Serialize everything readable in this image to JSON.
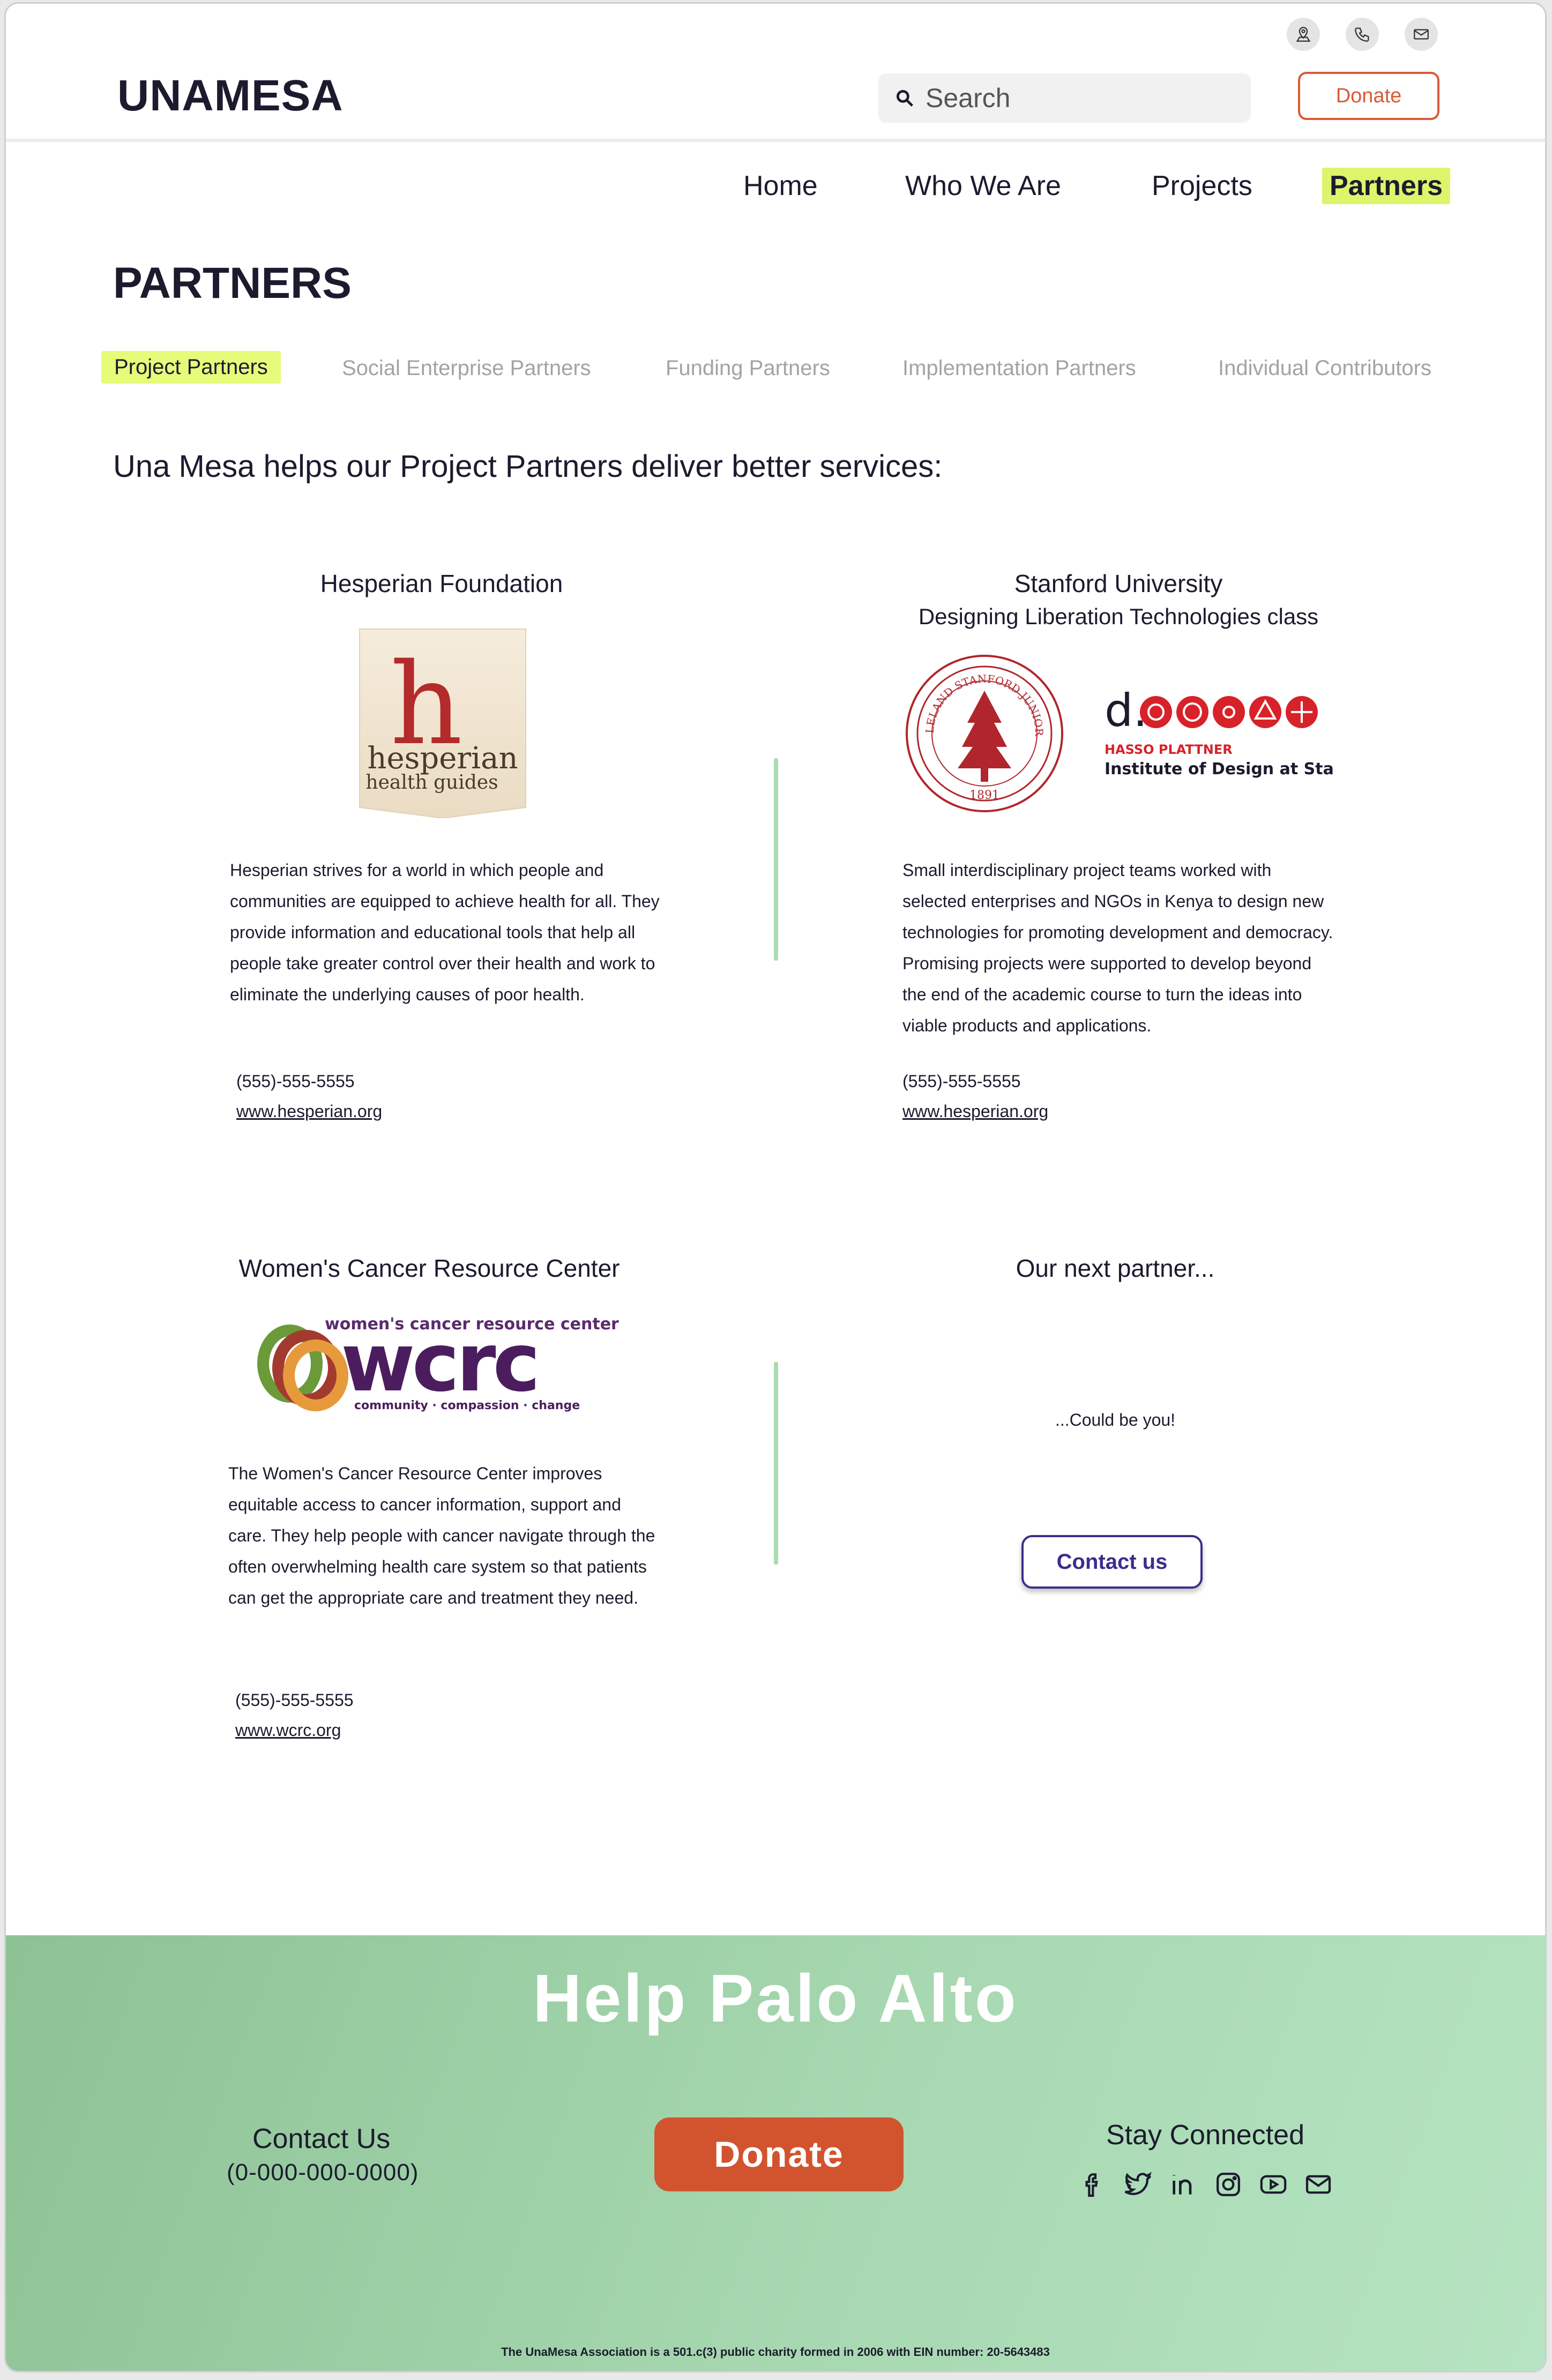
{
  "header": {
    "logo": "UNAMESA",
    "search_placeholder": "Search",
    "donate_label": "Donate",
    "utility_icons": [
      "location-icon",
      "phone-icon",
      "mail-icon"
    ]
  },
  "nav": {
    "items": [
      {
        "label": "Home"
      },
      {
        "label": "Who We Are"
      },
      {
        "label": "Projects"
      },
      {
        "label": "Partners",
        "active": true
      }
    ]
  },
  "page": {
    "title": "PARTNERS",
    "tabs": [
      {
        "label": "Project Partners",
        "active": true
      },
      {
        "label": "Social Enterprise Partners"
      },
      {
        "label": "Funding Partners"
      },
      {
        "label": "Implementation Partners"
      },
      {
        "label": "Individual Contributors"
      }
    ],
    "intro": "Una Mesa helps our Project Partners deliver better services:"
  },
  "partners": [
    {
      "name": "Hesperian Foundation",
      "logo_text": [
        "h",
        "hesperian",
        "health guides"
      ],
      "description": "Hesperian strives for a world in which people and communities are equipped to achieve health for all. They provide information and educational tools that help all people take greater control over their health and work to eliminate the underlying causes of poor health.",
      "phone": "(555)-555-5555",
      "url": "www.hesperian.org"
    },
    {
      "name": "Stanford University",
      "subtitle": "Designing Liberation Technologies class",
      "logo_text": [
        "LELAND STANFORD JUNIOR UNIVERSITY",
        "1891",
        "d.",
        "HASSO PLATTNER",
        "Institute of Design at Stanford"
      ],
      "description": "Small interdisciplinary project teams worked with selected enterprises and NGOs in Kenya to design new technologies for promoting development and democracy. Promising projects were supported to develop beyond the end of the academic course to turn the ideas into viable products and applications.",
      "phone": "(555)-555-5555",
      "url": "www.hesperian.org"
    },
    {
      "name": "Women's Cancer Resource Center",
      "logo_text": [
        "women's cancer resource center",
        "wcrc",
        "community · compassion · change"
      ],
      "description": "The Women's Cancer Resource Center improves equitable access to cancer information, support and care. They help people with cancer navigate through the often overwhelming health care system so that patients can get the appropriate care and treatment they need.",
      "phone": "(555)-555-5555",
      "url": "www.wcrc.org"
    },
    {
      "name": "Our next partner...",
      "description": "...Could be you!",
      "button_label": "Contact us"
    }
  ],
  "footer": {
    "title": "Help Palo Alto",
    "contact_heading": "Contact Us",
    "contact_phone": "(0-000-000-0000)",
    "donate_label": "Donate",
    "stay_connected": "Stay Connected",
    "social_icons": [
      "facebook-icon",
      "twitter-icon",
      "linkedin-icon",
      "instagram-icon",
      "youtube-icon",
      "mail-icon"
    ],
    "legal": "The UnaMesa Association is a 501.c(3) public charity formed in 2006 with EIN number: 20-5643483"
  },
  "colors": {
    "accent_orange": "#d95a38",
    "highlight_lime": "#dcf56a",
    "footer_green": "#a7d8b1",
    "button_purple": "#3a2e8c",
    "divider_green": "#a9dcb0"
  }
}
